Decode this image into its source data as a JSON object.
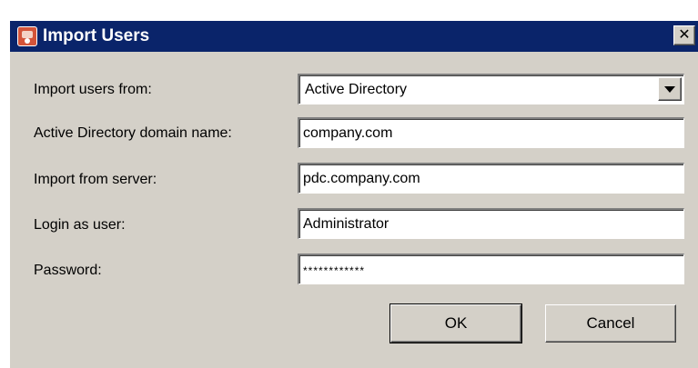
{
  "dialog": {
    "title": "Import Users",
    "icon": "user-import-app-icon",
    "close_glyph": "✕"
  },
  "form": {
    "import_from": {
      "label": "Import users from:",
      "value": "Active Directory"
    },
    "domain": {
      "label": "Active Directory domain name:",
      "value": "company.com"
    },
    "server": {
      "label": "Import from server:",
      "value": "pdc.company.com"
    },
    "login": {
      "label": "Login as user:",
      "value": "Administrator"
    },
    "password": {
      "label": "Password:",
      "value": "************"
    }
  },
  "buttons": {
    "ok": "OK",
    "cancel": "Cancel"
  },
  "colors": {
    "titlebar": "#0a246a",
    "dialog_bg": "#d4d0c8"
  }
}
